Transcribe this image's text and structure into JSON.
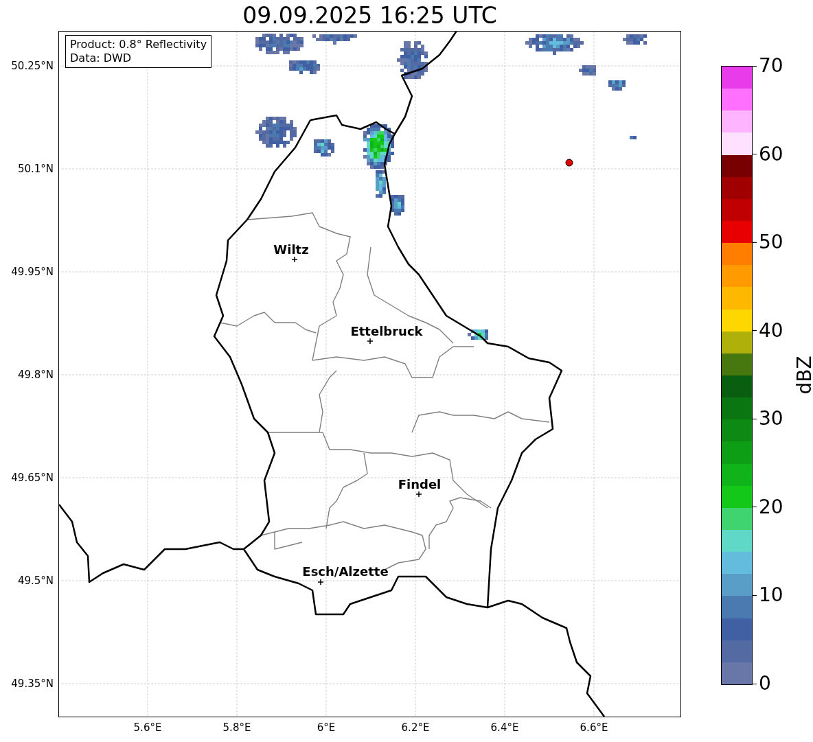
{
  "title": "09.09.2025 16:25 UTC",
  "info_box": {
    "lines": [
      "Product: 0.8° Reflectivity",
      "Data: DWD"
    ]
  },
  "map": {
    "lat_ticks": [
      "50.25°N",
      "50.1°N",
      "49.95°N",
      "49.8°N",
      "49.65°N",
      "49.5°N",
      "49.35°N"
    ],
    "lon_ticks": [
      "5.6°E",
      "5.8°E",
      "6°E",
      "6.2°E",
      "6.4°E",
      "6.6°E"
    ],
    "cities": [
      "Wiltz",
      "Ettelbruck",
      "Findel",
      "Esch/Alzette"
    ]
  },
  "colorbar": {
    "label": "dBZ",
    "ticks": [
      "70",
      "60",
      "50",
      "40",
      "30",
      "20",
      "10",
      "0"
    ],
    "segments": [
      {
        "color": "#e83cea"
      },
      {
        "color": "#ff70ff"
      },
      {
        "color": "#ffb4ff"
      },
      {
        "color": "#ffe0ff"
      },
      {
        "color": "#780000"
      },
      {
        "color": "#a00000"
      },
      {
        "color": "#c00000"
      },
      {
        "color": "#e60000"
      },
      {
        "color": "#ff7e00"
      },
      {
        "color": "#ff9a00"
      },
      {
        "color": "#ffb800"
      },
      {
        "color": "#ffd700"
      },
      {
        "color": "#b0b00a"
      },
      {
        "color": "#46780f"
      },
      {
        "color": "#0a5e10"
      },
      {
        "color": "#0a7612"
      },
      {
        "color": "#0c8a14"
      },
      {
        "color": "#0e9e16"
      },
      {
        "color": "#10b41a"
      },
      {
        "color": "#14c81a"
      },
      {
        "color": "#40d470"
      },
      {
        "color": "#60d8c8"
      },
      {
        "color": "#63bcdb"
      },
      {
        "color": "#5a9ec8"
      },
      {
        "color": "#4a7ab0"
      },
      {
        "color": "#4060a3"
      },
      {
        "color": "#546aa3"
      },
      {
        "color": "#6877a8"
      }
    ]
  }
}
